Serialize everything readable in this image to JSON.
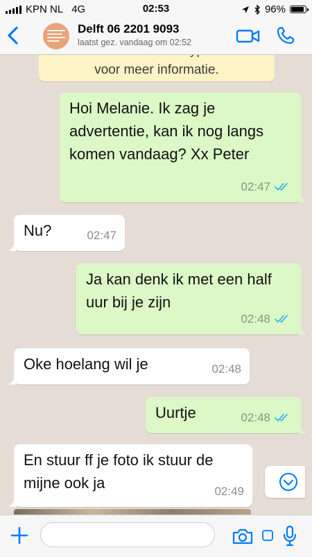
{
  "status_bar": {
    "carrier": "KPN NL",
    "network": "4G",
    "time": "02:53",
    "battery": "96%",
    "battery_level": 0.96
  },
  "header": {
    "contact_name": "Delft 06 2201 9093",
    "last_seen": "laatst gez. vandaag om 02:52"
  },
  "encryption_notice": {
    "line1": "met end-to-end encryptie. Tik",
    "line2": "voor meer informatie."
  },
  "messages": [
    {
      "direction": "out",
      "text": "Hoi Melanie. Ik zag je advertentie, kan ik nog langs komen vandaag? Xx Peter",
      "time": "02:47",
      "status": "read"
    },
    {
      "direction": "in",
      "text": "Nu?",
      "time": "02:47"
    },
    {
      "direction": "out",
      "text": "Ja kan denk ik met een half uur bij je zijn",
      "time": "02:48",
      "status": "read"
    },
    {
      "direction": "in",
      "text": "Oke hoelang wil je",
      "time": "02:48"
    },
    {
      "direction": "out",
      "text": "Uurtje",
      "time": "02:48",
      "status": "read"
    },
    {
      "direction": "in",
      "text": "En stuur ff je foto ik stuur de mijne ook ja",
      "time": "02:49"
    }
  ],
  "input": {
    "placeholder": "",
    "value": ""
  },
  "colors": {
    "accent": "#007aff",
    "outgoing_bubble": "#dcf8c6",
    "incoming_bubble": "#ffffff",
    "read_ticks": "#34b7f1",
    "chat_background": "#e5ddd5"
  },
  "icons": {
    "back": "chevron-left-icon",
    "video": "video-camera-icon",
    "call": "phone-icon",
    "plus": "plus-icon",
    "camera": "camera-icon",
    "sticker": "sticker-icon",
    "mic": "microphone-icon",
    "scroll_down": "chevron-down-circle-icon"
  }
}
